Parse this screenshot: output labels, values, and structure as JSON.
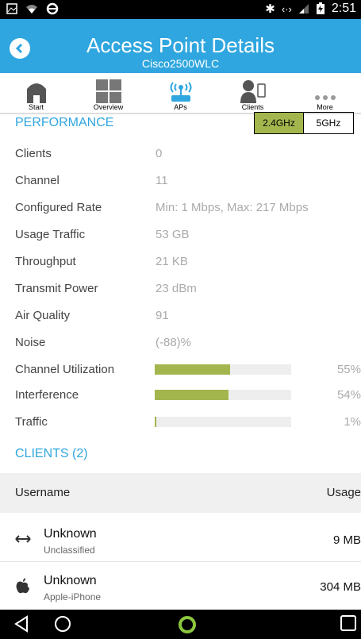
{
  "status_bar": {
    "time": "2:51"
  },
  "header": {
    "title": "Access Point Details",
    "subtitle": "Cisco2500WLC"
  },
  "toolbar": [
    {
      "label": "Start",
      "icon": "home-icon"
    },
    {
      "label": "Overview",
      "icon": "grid-icon"
    },
    {
      "label": "APs",
      "icon": "access-point-icon"
    },
    {
      "label": "Clients",
      "icon": "clients-icon"
    },
    {
      "label": "More",
      "icon": "more-icon"
    }
  ],
  "performance": {
    "title": "PERFORMANCE",
    "bands": [
      "2.4GHz",
      "5GHz"
    ],
    "active_band": "2.4GHz",
    "rows": [
      {
        "label": "Clients",
        "value": "0"
      },
      {
        "label": "Channel",
        "value": "11"
      },
      {
        "label": "Configured Rate",
        "value": "Min: 1 Mbps, Max: 217 Mbps"
      },
      {
        "label": "Usage Traffic",
        "value": "53 GB"
      },
      {
        "label": "Throughput",
        "value": "21 KB"
      },
      {
        "label": "Transmit Power",
        "value": "23 dBm"
      },
      {
        "label": "Air Quality",
        "value": "91"
      },
      {
        "label": "Noise",
        "value": "(-88)%"
      }
    ],
    "bars": [
      {
        "label": "Channel Utilization",
        "percent_text": "55%",
        "percent": 55
      },
      {
        "label": "Interference",
        "percent_text": "54%",
        "percent": 54
      },
      {
        "label": "Traffic",
        "percent_text": "1%",
        "percent": 1
      }
    ]
  },
  "clients": {
    "title": "CLIENTS (2)",
    "col_username": "Username",
    "col_usage": "Usage",
    "items": [
      {
        "name": "Unknown",
        "type": "Unclassified",
        "usage": "9 MB",
        "icon": "arrows-icon"
      },
      {
        "name": "Unknown",
        "type": "Apple-iPhone",
        "usage": "304 MB",
        "icon": "apple-icon"
      }
    ]
  },
  "colors": {
    "header": "#2fa6df",
    "accent_green": "#a3b64e",
    "section_blue": "#2fa6df"
  }
}
